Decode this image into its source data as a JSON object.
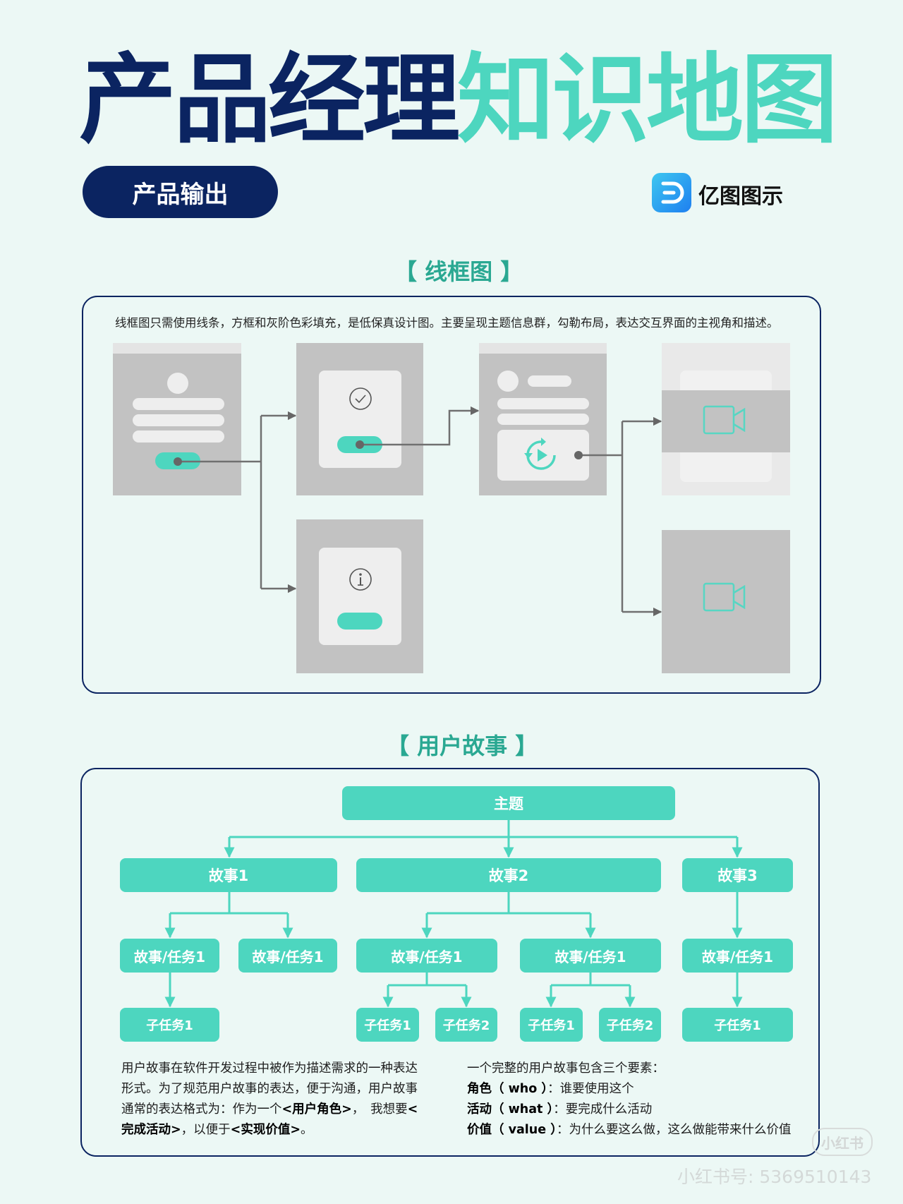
{
  "title": {
    "part1": "产品经理",
    "part2": "知识地图"
  },
  "section_pill": "产品输出",
  "brand": {
    "name": "亿图图示",
    "icon": "edraw-logo-icon"
  },
  "wireframe": {
    "heading": "【 线框图 】",
    "description": "线框图只需使用线条，方框和灰阶色彩填充，是低保真设计图。主要呈现主题信息群，勾勒布局，表达交互界面的主视角和描述。",
    "icons": [
      "check-circle-icon",
      "info-circle-icon",
      "play-replay-icon",
      "video-camera-icon"
    ]
  },
  "user_story": {
    "heading": "【 用户故事 】",
    "theme": "主题",
    "stories": [
      "故事1",
      "故事2",
      "故事3"
    ],
    "tasks": [
      "故事/任务1",
      "故事/任务1",
      "故事/任务1",
      "故事/任务1",
      "故事/任务1"
    ],
    "subtasks": [
      "子任务1",
      "子任务1",
      "子任务2",
      "子任务1",
      "子任务2",
      "子任务1"
    ],
    "left_text": {
      "p1": "用户故事在软件开发过程中被作为描述需求的一种表达形式。为了规范用户故事的表达，便于沟通，用户故事通常的表达格式为：作为一个",
      "role": "<用户角色>",
      "p2": "，　我想要",
      "activity": "<完成活动>",
      "p3": "，以便于",
      "value": "<实现价值>",
      "p4": "。"
    },
    "right_text": {
      "intro": "一个完整的用户故事包含三个要素：",
      "items": [
        {
          "label": "角色（ who ）",
          "text": "：谁要使用这个"
        },
        {
          "label": "活动（ what ）",
          "text": "：要完成什么活动"
        },
        {
          "label": "价值（ value ）",
          "text": "：为什么要这么做，这么做能带来什么价值"
        }
      ]
    }
  },
  "watermark": {
    "logo": "小红书",
    "id": "小红书号: 5369510143"
  },
  "colors": {
    "navy": "#0b2461",
    "teal": "#4dd6bf",
    "teal_text": "#2aa892",
    "background": "#ecf8f5",
    "gray": "#c2c2c2"
  }
}
